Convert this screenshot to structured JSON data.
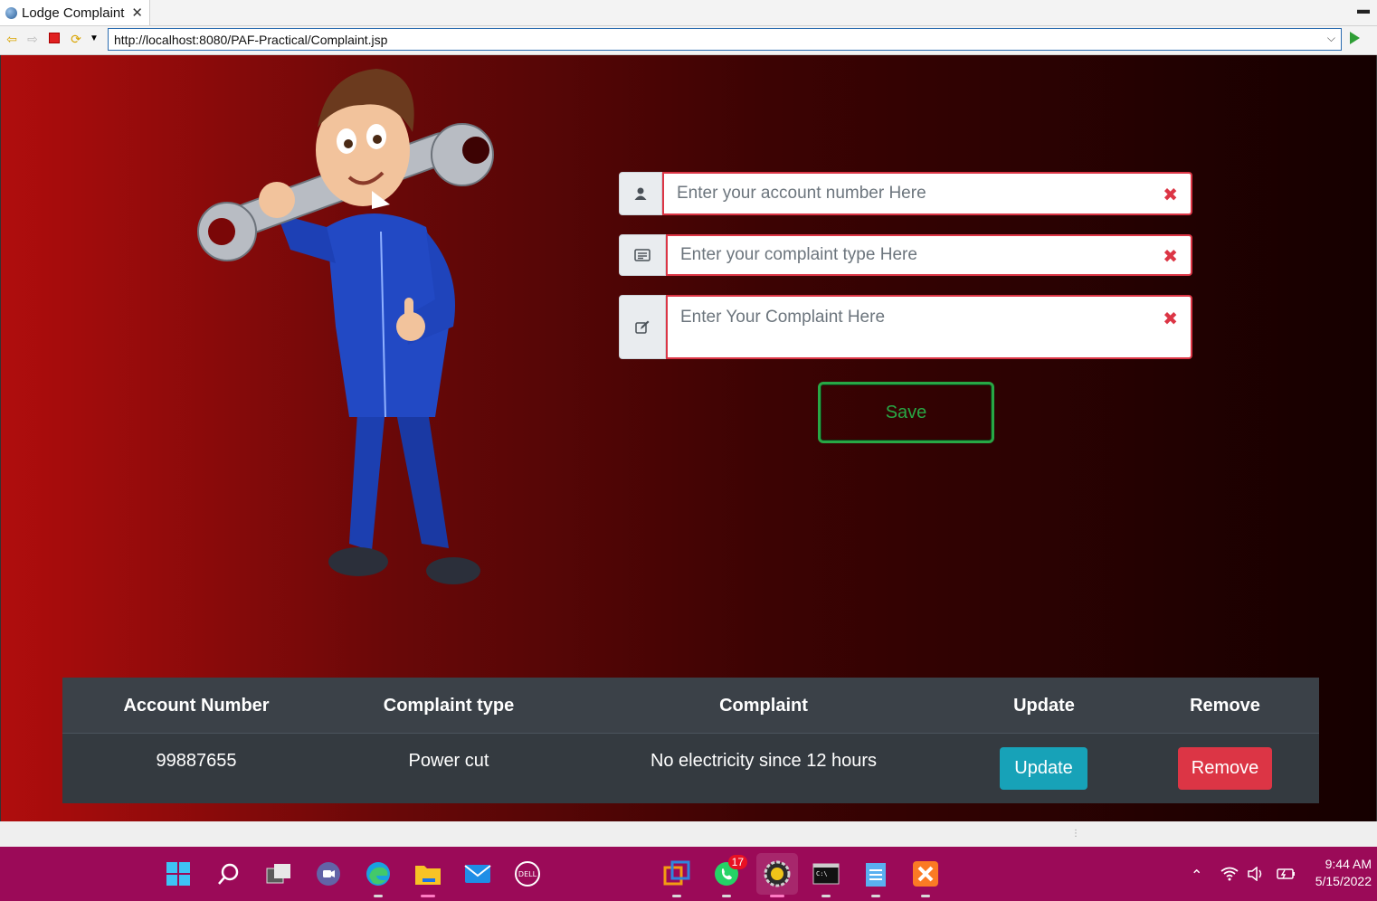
{
  "browser": {
    "tab_title": "Lodge Complaint",
    "tab_close": "✕",
    "url": "http://localhost:8080/PAF-Practical/Complaint.jsp"
  },
  "form": {
    "account_placeholder": "Enter your account number Here",
    "type_placeholder": "Enter your complaint type Here",
    "complaint_placeholder": "Enter Your Complaint Here",
    "error_mark": "✖",
    "save_label": "Save"
  },
  "table": {
    "headers": [
      "Account Number",
      "Complaint type",
      "Complaint",
      "Update",
      "Remove"
    ],
    "rows": [
      {
        "account": "99887655",
        "type": "Power cut",
        "complaint": "No electricity since 12 hours",
        "update_label": "Update",
        "remove_label": "Remove"
      }
    ]
  },
  "taskbar": {
    "whatsapp_badge": "17",
    "time": "9:44 AM",
    "date": "5/15/2022"
  },
  "colors": {
    "accent_error": "#dc3545",
    "accent_success": "#28a745",
    "accent_info": "#17a2b8",
    "taskbar": "#9b0a58"
  }
}
